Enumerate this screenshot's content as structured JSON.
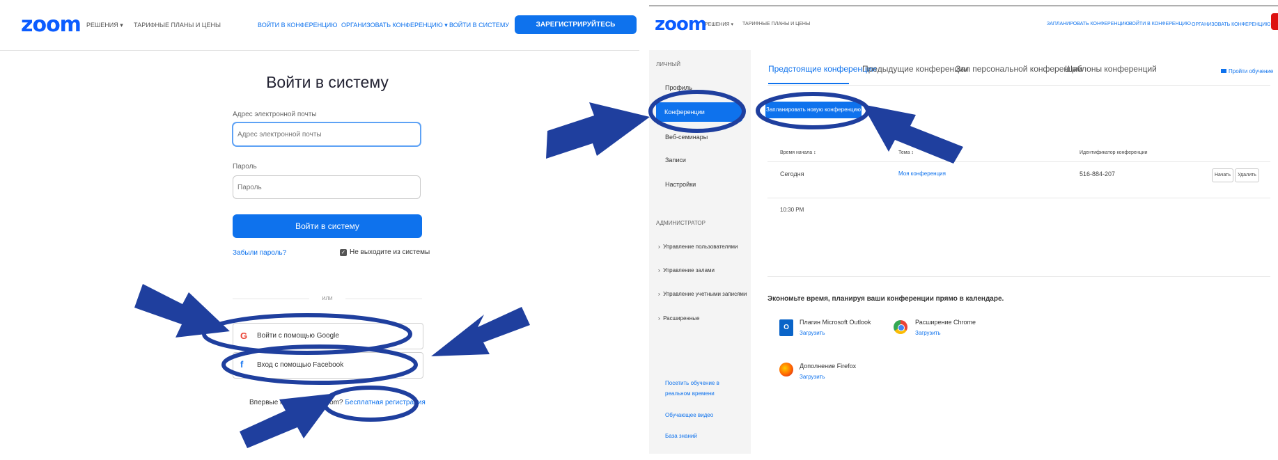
{
  "left": {
    "logo": "zoom",
    "nav": {
      "solutions": "РЕШЕНИЯ ▾",
      "plans": "ТАРИФНЫЕ ПЛАНЫ И ЦЕНЫ",
      "join": "ВОЙТИ В КОНФЕРЕНЦИЮ",
      "host": "ОРГАНИЗОВАТЬ КОНФЕРЕНЦИЮ ▾",
      "signin": "ВОЙТИ В СИСТЕМУ",
      "signup": "ЗАРЕГИСТРИРУЙТЕСЬ БЕСПЛАТНО"
    },
    "title": "Войти в систему",
    "email_label": "Адрес электронной почты",
    "email_placeholder": "Адрес электронной почты",
    "password_label": "Пароль",
    "password_placeholder": "Пароль",
    "login_button": "Войти в систему",
    "forgot": "Забыли пароль?",
    "stay_signed": "Не выходите из системы",
    "or": "или",
    "google": "Войти с помощью Google",
    "facebook": "Вход с помощью Facebook",
    "new_user_prefix": "Впервые пользуетесь Zoom?",
    "free_signup": "Бесплатная регистрация"
  },
  "right": {
    "logo": "zoom",
    "nav": {
      "solutions": "РЕШЕНИЯ ▾",
      "plans": "ТАРИФНЫЕ ПЛАНЫ И ЦЕНЫ",
      "schedule": "ЗАПЛАНИРОВАТЬ КОНФЕРЕНЦИЮ",
      "join": "ВОЙТИ В КОНФЕРЕНЦИЮ",
      "host": "ОРГАНИЗОВАТЬ КОНФЕРЕНЦИЮ ▾"
    },
    "sidebar": {
      "personal_header": "ЛИЧНЫЙ",
      "personal_items": [
        "Профиль",
        "Конференции",
        "Веб-семинары",
        "Записи",
        "Настройки"
      ],
      "admin_header": "АДМИНИСТРАТОР",
      "admin_items": [
        "Управление пользователями",
        "Управление залами",
        "Управление учетными записями",
        "Расширенные"
      ],
      "bottom_links": [
        "Посетить обучение в реальном времени",
        "Обучающее видео",
        "База знаний"
      ]
    },
    "tabs": [
      "Предстоящие конференции",
      "Предыдущие конференции",
      "Зал персональной конференции",
      "Шаблоны конференций"
    ],
    "training": "Пройти обучение",
    "schedule_button": "Запланировать новую конференцию",
    "table": {
      "headers": [
        "Время начала ↕",
        "Тема ↕",
        "Идентификатор конференции"
      ],
      "row": {
        "date": "Сегодня",
        "time": "10:30 PM",
        "topic": "Моя конференция",
        "id": "516-884-207",
        "start": "Начать",
        "delete": "Удалить"
      }
    },
    "calendar_promo": "Экономьте время, планируя ваши конференции прямо в календаре.",
    "plugins": [
      {
        "name": "Плагин Microsoft Outlook",
        "action": "Загрузить"
      },
      {
        "name": "Расширение Chrome",
        "action": "Загрузить"
      },
      {
        "name": "Дополнение Firefox",
        "action": "Загрузить"
      }
    ]
  },
  "colors": {
    "accent": "#0e72ed",
    "annotation": "#1f3f9e"
  }
}
